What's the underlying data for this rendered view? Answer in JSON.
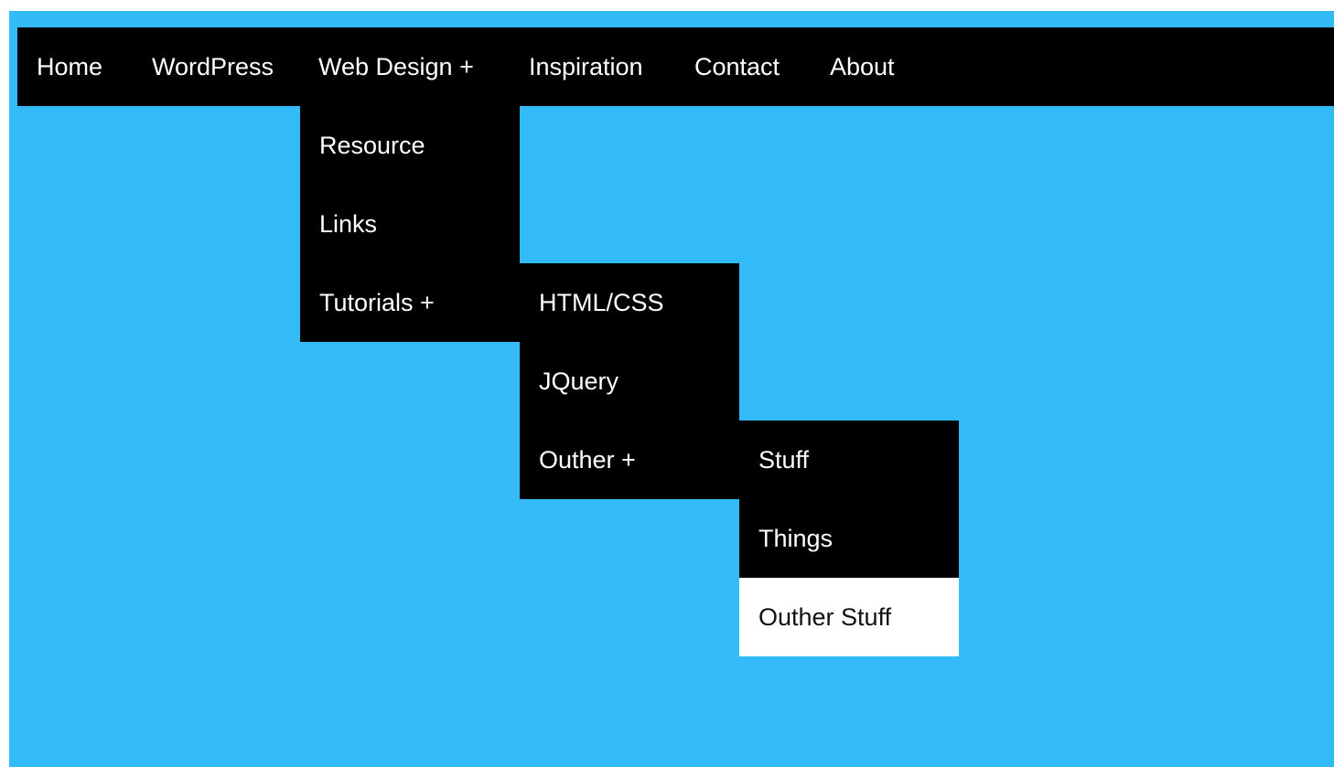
{
  "colors": {
    "page_background": "#33bbf8",
    "menu_background": "#000000",
    "menu_text": "#ffffff",
    "hover_background": "#ffffff",
    "hover_text": "#111111"
  },
  "nav": {
    "items": [
      {
        "label": "Home"
      },
      {
        "label": "WordPress"
      },
      {
        "label": "Web Design +"
      },
      {
        "label": "Inspiration"
      },
      {
        "label": "Contact"
      },
      {
        "label": "About"
      }
    ]
  },
  "web_design_menu": {
    "items": [
      {
        "label": "Resource"
      },
      {
        "label": "Links"
      },
      {
        "label": "Tutorials +"
      }
    ]
  },
  "tutorials_menu": {
    "items": [
      {
        "label": "HTML/CSS"
      },
      {
        "label": "JQuery"
      },
      {
        "label": "Outher +"
      }
    ]
  },
  "outher_menu": {
    "items": [
      {
        "label": "Stuff"
      },
      {
        "label": "Things"
      },
      {
        "label": "Outher Stuff",
        "state": "hovered"
      }
    ]
  }
}
